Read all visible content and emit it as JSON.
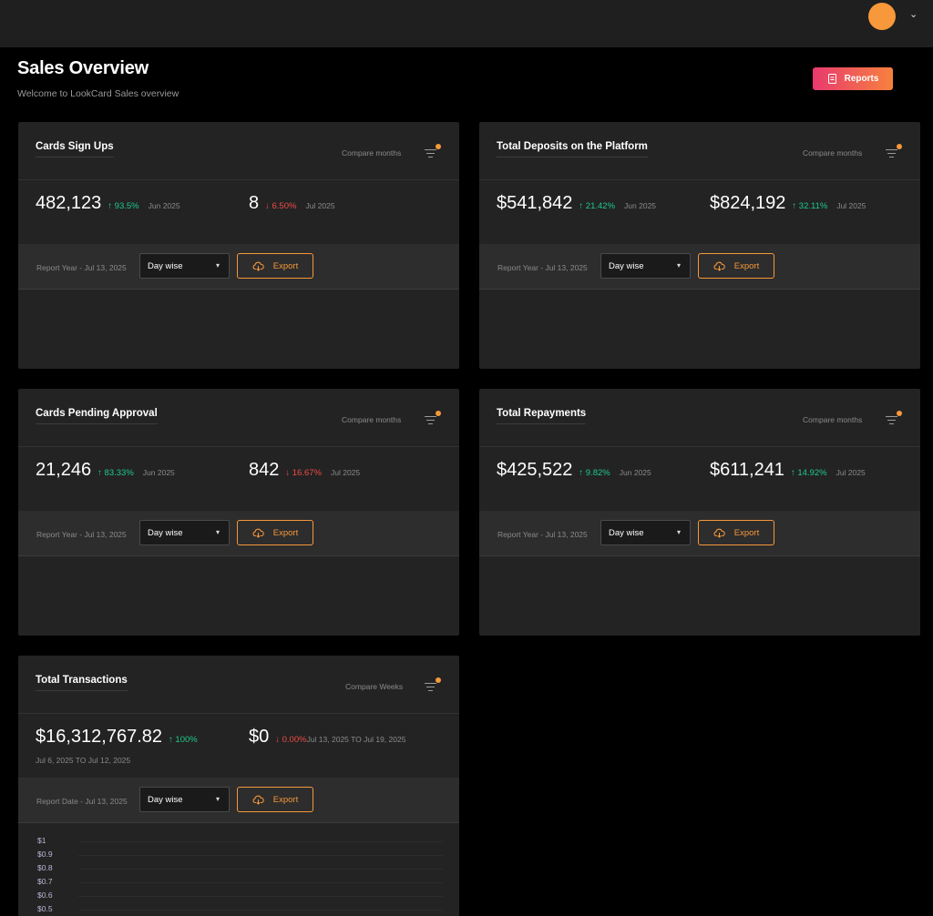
{
  "header": {
    "avatar_color": "#f7983a",
    "menu_icon": "chevron-down-icon",
    "chevron": "⌄"
  },
  "page": {
    "title": "Sales Overview",
    "subtitle": "Welcome to LookCard Sales overview"
  },
  "reports_button": {
    "label": "Reports",
    "icon": "report-icon"
  },
  "colors": {
    "accent": "#f7983a",
    "up": "#1ec98b",
    "down": "#ef4b47",
    "card": "#232323"
  },
  "cards": [
    {
      "title": "Cards Sign Ups",
      "compare_label": "Compare months",
      "primary": {
        "value": "482,123",
        "change": "↑ 93.5%",
        "trend": "up",
        "period": "Jun 2025"
      },
      "secondary": {
        "value": "8",
        "change": "↓ 6.50%",
        "trend": "down",
        "period": "Jul 2025"
      },
      "report_label": "Report Year - Jul 13, 2025",
      "select_value": "Day wise",
      "export_label": "Export"
    },
    {
      "title": "Total Deposits on the Platform",
      "compare_label": "Compare months",
      "primary": {
        "value": "$541,842",
        "change": "↑ 21.42%",
        "trend": "up",
        "period": "Jun 2025"
      },
      "secondary": {
        "value": "$824,192",
        "change": "↑ 32.11%",
        "trend": "up",
        "period": "Jul 2025"
      },
      "report_label": "Report Year - Jul 13, 2025",
      "select_value": "Day wise",
      "export_label": "Export"
    },
    {
      "title": "Cards Pending Approval",
      "compare_label": "Compare months",
      "primary": {
        "value": "21,246",
        "change": "↑ 83.33%",
        "trend": "up",
        "period": "Jun 2025"
      },
      "secondary": {
        "value": "842",
        "change": "↓ 16.67%",
        "trend": "down",
        "period": "Jul 2025"
      },
      "report_label": "Report Year - Jul 13, 2025",
      "select_value": "Day wise",
      "export_label": "Export"
    },
    {
      "title": "Total Repayments",
      "compare_label": "Compare months",
      "primary": {
        "value": "$425,522",
        "change": "↑ 9.82%",
        "trend": "up",
        "period": "Jun 2025"
      },
      "secondary": {
        "value": "$611,241",
        "change": "↑ 14.92%",
        "trend": "up",
        "period": "Jul 2025"
      },
      "report_label": "Report Year - Jul 13, 2025",
      "select_value": "Day wise",
      "export_label": "Export"
    },
    {
      "title": "Total Transactions",
      "compare_label": "Compare Weeks",
      "primary": {
        "value": "$16,312,767.82",
        "change": "↑ 100%",
        "trend": "up",
        "range": "Jul 6, 2025 TO Jul 12, 2025"
      },
      "secondary": {
        "value": "$0",
        "change": "↓ 0.00%",
        "trend": "down",
        "period": "Jul 13, 2025 TO Jul 19, 2025"
      },
      "report_label": "Report Date - Jul 13, 2025",
      "select_value": "Day wise",
      "export_label": "Export",
      "y_ticks": [
        "$1",
        "$0.9",
        "$0.8",
        "$0.7",
        "$0.6",
        "$0.5"
      ]
    }
  ]
}
